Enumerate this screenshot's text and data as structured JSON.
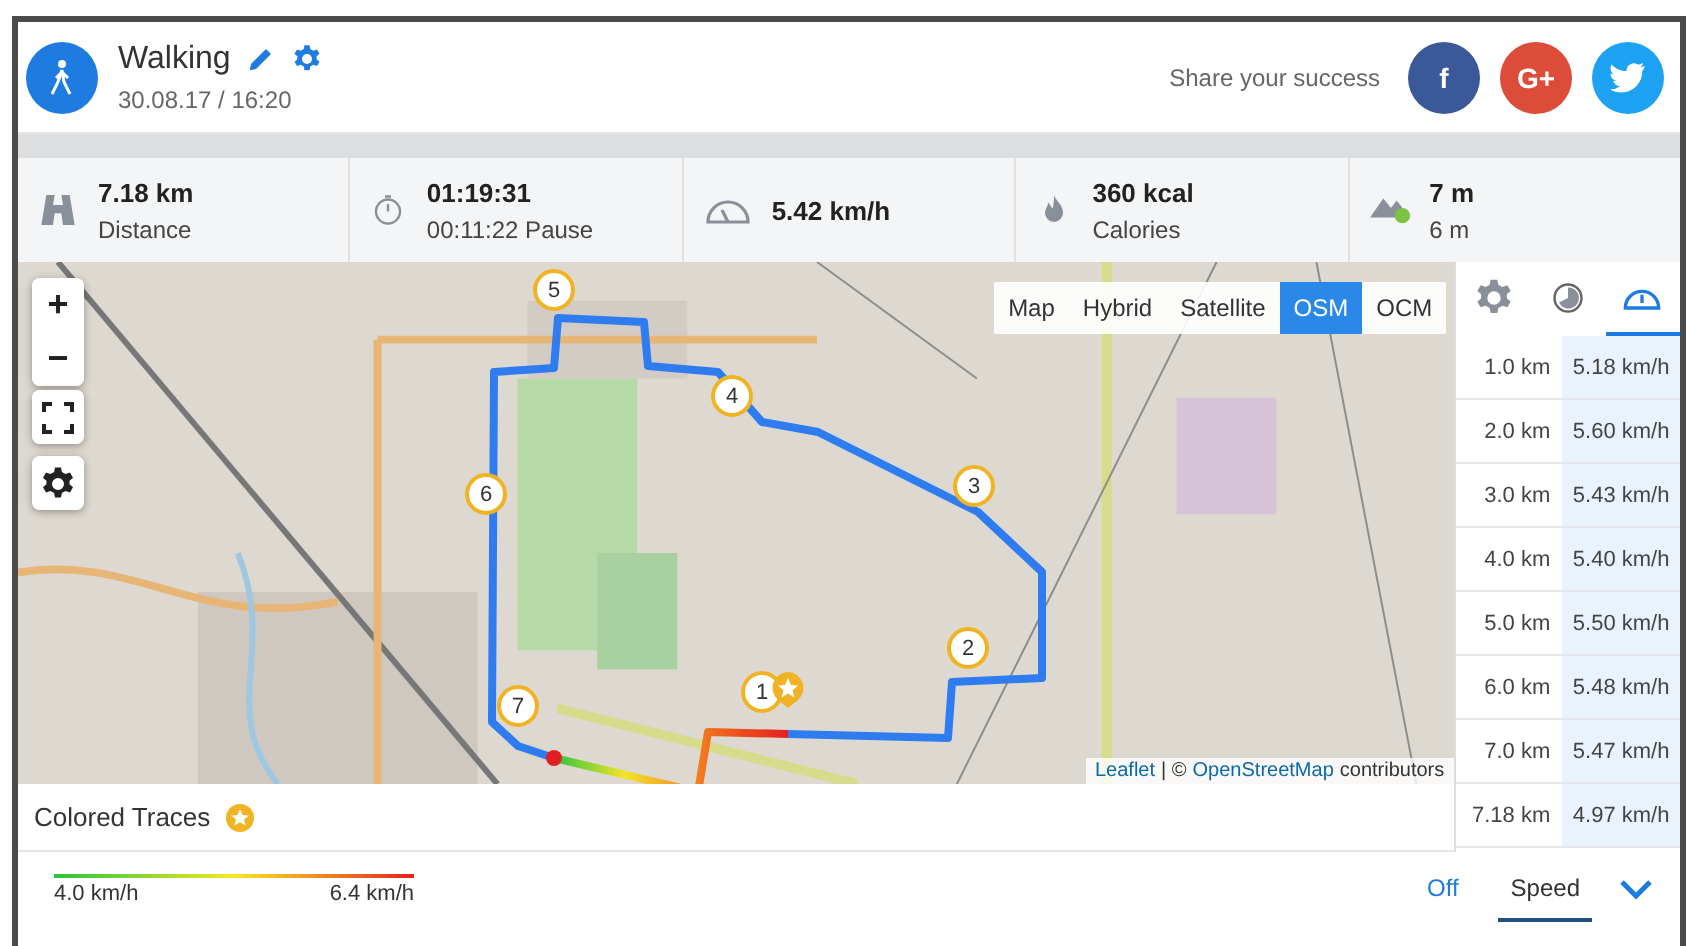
{
  "activity": {
    "title": "Walking",
    "date": "30.08.17 / 16:20"
  },
  "share": {
    "label": "Share your success",
    "buttons": [
      {
        "kind": "facebook",
        "label": "f"
      },
      {
        "kind": "google",
        "label": "G+"
      },
      {
        "kind": "twitter"
      }
    ]
  },
  "stats": [
    {
      "kind": "road",
      "value": "7.18 km",
      "label": "Distance"
    },
    {
      "kind": "stopwatch",
      "value": "01:19:31",
      "label": "00:11:22 Pause"
    },
    {
      "kind": "speedometer",
      "value": "5.42 km/h"
    },
    {
      "kind": "flame",
      "value": "360 kcal",
      "label": "Calories"
    },
    {
      "kind": "mountain",
      "value": "7 m",
      "label": "6 m"
    }
  ],
  "map": {
    "layers": [
      {
        "label": "Map",
        "selected": false
      },
      {
        "label": "Hybrid",
        "selected": false
      },
      {
        "label": "Satellite",
        "selected": false
      },
      {
        "label": "OSM",
        "selected": true
      },
      {
        "label": "OCM",
        "selected": false
      }
    ],
    "zoom_in": "+",
    "zoom_out": "−",
    "markers": [
      {
        "label": "1"
      },
      {
        "label": "2"
      },
      {
        "label": "3"
      },
      {
        "label": "4"
      },
      {
        "label": "5"
      },
      {
        "label": "6"
      },
      {
        "label": "7"
      }
    ],
    "attribution": {
      "link1": "Leaflet",
      "separator": "| ©",
      "link2": "OpenStreetMap",
      "suffix": "contributors"
    }
  },
  "panel": {
    "tabs": [
      {
        "kind": "settings",
        "selected": false
      },
      {
        "kind": "pie",
        "selected": false
      },
      {
        "kind": "speed",
        "selected": true
      }
    ],
    "rows": [
      {
        "distance": "1.0 km",
        "speed": "5.18 km/h"
      },
      {
        "distance": "2.0 km",
        "speed": "5.60 km/h"
      },
      {
        "distance": "3.0 km",
        "speed": "5.43 km/h"
      },
      {
        "distance": "4.0 km",
        "speed": "5.40 km/h"
      },
      {
        "distance": "5.0 km",
        "speed": "5.50 km/h"
      },
      {
        "distance": "6.0 km",
        "speed": "5.48 km/h"
      },
      {
        "distance": "7.0 km",
        "speed": "5.47 km/h"
      },
      {
        "distance": "7.18 km",
        "speed": "4.97 km/h"
      }
    ]
  },
  "traces": {
    "title": "Colored Traces",
    "legend_min": "4.0 km/h",
    "legend_max": "6.4 km/h",
    "options": [
      {
        "label": "Off",
        "selected": false
      },
      {
        "label": "Speed",
        "selected": true
      }
    ]
  }
}
